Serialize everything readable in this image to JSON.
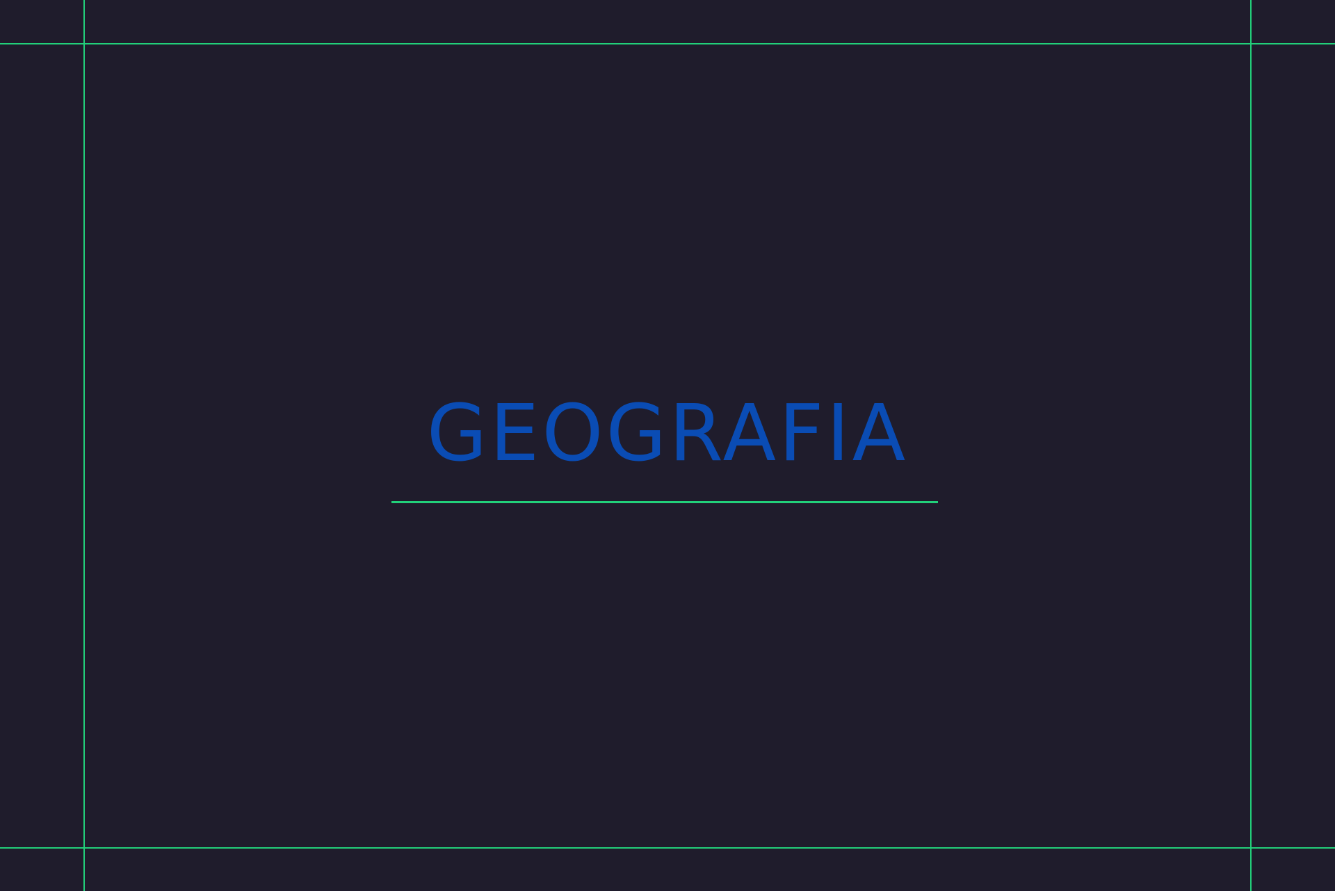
{
  "page": {
    "title": "GEOGRAFIA"
  },
  "colors": {
    "background": "#1f1c2c",
    "title": "#0a4cb4",
    "guides": "#22d07a"
  }
}
